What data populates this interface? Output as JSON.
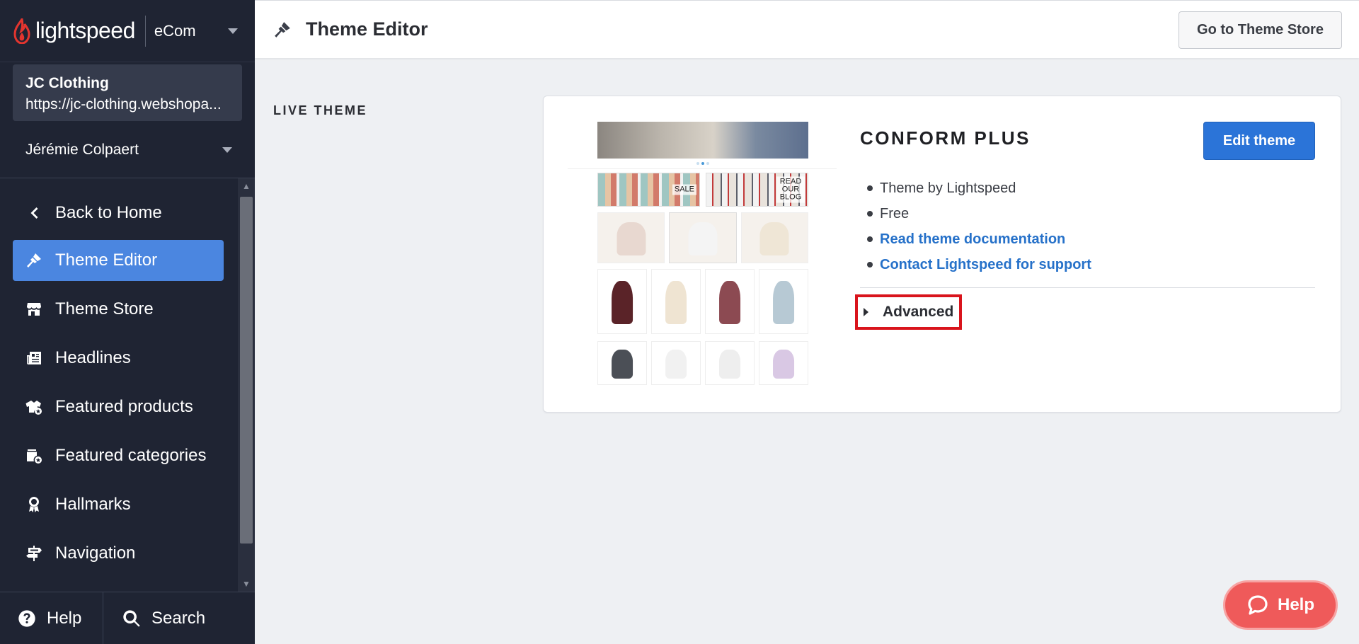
{
  "brand": {
    "logo_text": "lightspeed",
    "product": "eCom"
  },
  "shop": {
    "name": "JC Clothing",
    "url": "https://jc-clothing.webshopa..."
  },
  "user": {
    "name": "Jérémie Colpaert"
  },
  "sidebar": {
    "items": [
      {
        "label": "Back to Home",
        "icon": "chevron-left-icon"
      },
      {
        "label": "Theme Editor",
        "icon": "paintbrush-icon",
        "active": true
      },
      {
        "label": "Theme Store",
        "icon": "store-icon"
      },
      {
        "label": "Headlines",
        "icon": "newspaper-icon"
      },
      {
        "label": "Featured products",
        "icon": "featured-products-icon"
      },
      {
        "label": "Featured categories",
        "icon": "featured-categories-icon"
      },
      {
        "label": "Hallmarks",
        "icon": "ribbon-icon"
      },
      {
        "label": "Navigation",
        "icon": "signpost-icon"
      }
    ],
    "footer": {
      "help": "Help",
      "search": "Search"
    }
  },
  "header": {
    "title": "Theme Editor",
    "store_button": "Go to Theme Store"
  },
  "main": {
    "section_label": "LIVE THEME",
    "theme": {
      "name": "CONFORM PLUS",
      "edit_button": "Edit theme",
      "info": [
        "Theme by Lightspeed",
        "Free"
      ],
      "links": [
        "Read theme documentation",
        "Contact Lightspeed for support"
      ],
      "advanced": "Advanced",
      "preview": {
        "banner_sale": "SALE",
        "banner_blog": "READ OUR BLOG"
      }
    }
  },
  "help_widget": {
    "label": "Help"
  },
  "colors": {
    "sidebar_bg": "#1f2433",
    "active_item": "#4b86e0",
    "primary_button": "#2b74d8",
    "link": "#2671c9",
    "help_widget": "#ef5a5a",
    "highlight_box": "#d9141c"
  }
}
